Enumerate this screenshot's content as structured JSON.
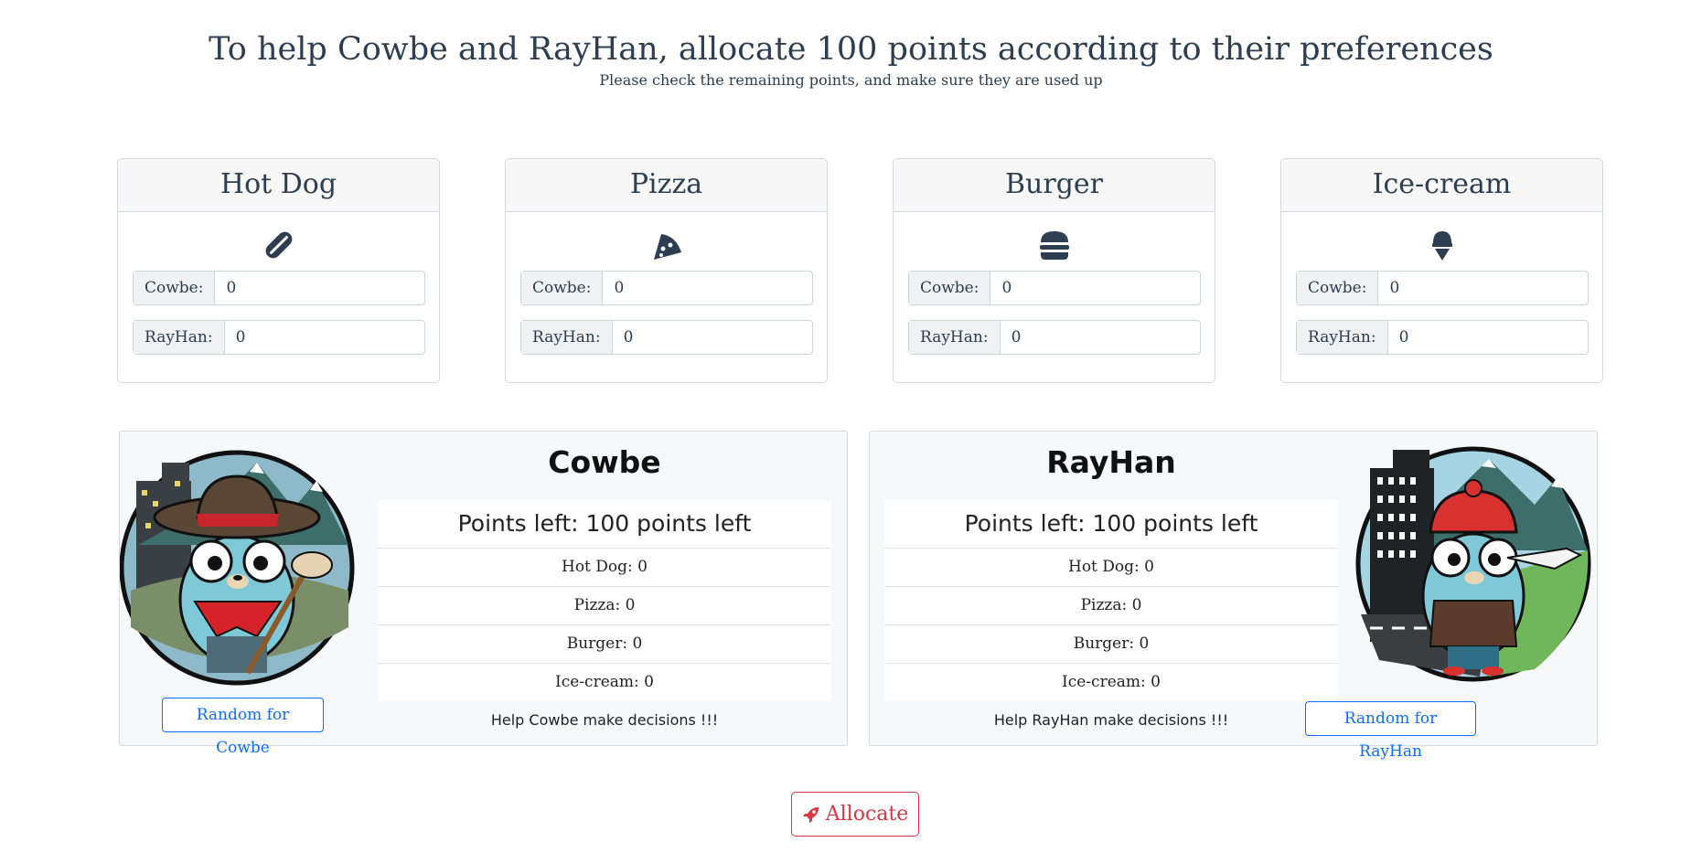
{
  "page": {
    "title": "To help Cowbe and RayHan, allocate 100 points according to their preferences",
    "subtitle": "Please check the remaining points, and make sure they are used up"
  },
  "foods": [
    {
      "name": "Hot Dog",
      "icon": "hotdog-icon",
      "cowbe_label": "Cowbe:",
      "cowbe_value": "0",
      "rayhan_label": "RayHan:",
      "rayhan_value": "0"
    },
    {
      "name": "Pizza",
      "icon": "pizza-icon",
      "cowbe_label": "Cowbe:",
      "cowbe_value": "0",
      "rayhan_label": "RayHan:",
      "rayhan_value": "0"
    },
    {
      "name": "Burger",
      "icon": "burger-icon",
      "cowbe_label": "Cowbe:",
      "cowbe_value": "0",
      "rayhan_label": "RayHan:",
      "rayhan_value": "0"
    },
    {
      "name": "Ice-cream",
      "icon": "ice-cream-icon",
      "cowbe_label": "Cowbe:",
      "cowbe_value": "0",
      "rayhan_label": "RayHan:",
      "rayhan_value": "0"
    }
  ],
  "cowbe": {
    "name": "Cowbe",
    "points_left": "Points left: 100 points left",
    "allocations": [
      "Hot Dog: 0",
      "Pizza: 0",
      "Burger: 0",
      "Ice-cream: 0"
    ],
    "help": "Help Cowbe make decisions !!!",
    "random_label": "Random for Cowbe",
    "avatar": "gopher-cowboy-avatar"
  },
  "rayhan": {
    "name": "RayHan",
    "points_left": "Points left: 100 points left",
    "allocations": [
      "Hot Dog: 0",
      "Pizza: 0",
      "Burger: 0",
      "Ice-cream: 0"
    ],
    "help": "Help RayHan make decisions !!!",
    "random_label": "Random for RayHan",
    "avatar": "gopher-winter-avatar"
  },
  "allocate": {
    "label": "Allocate",
    "icon": "rocket-icon"
  },
  "colors": {
    "primary": "#0d6efd",
    "danger": "#dc3545",
    "text": "#2c3e50"
  }
}
